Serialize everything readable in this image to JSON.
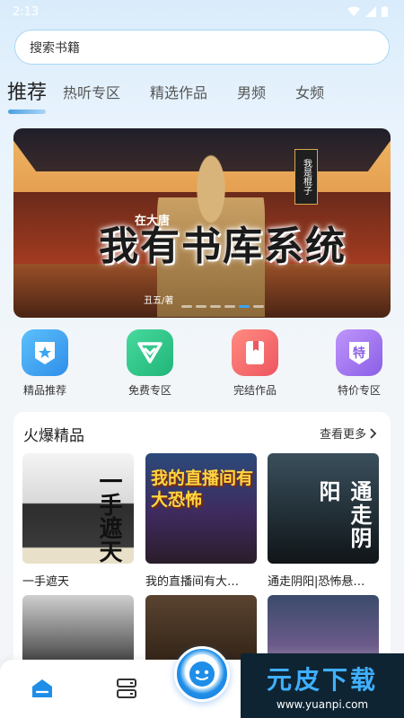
{
  "status_bar": {
    "time": "2:13"
  },
  "search": {
    "placeholder": "搜索书籍"
  },
  "tabs": [
    {
      "label": "推荐",
      "active": true
    },
    {
      "label": "热听专区"
    },
    {
      "label": "精选作品"
    },
    {
      "label": "男频"
    },
    {
      "label": "女频"
    }
  ],
  "banner": {
    "title": "我有书库系统",
    "subtitle": "在大唐",
    "author": "丑五/著",
    "tag": "我是棍子",
    "slide_count": 6,
    "active_slide": 4
  },
  "quick_entries": [
    {
      "label": "精品推荐",
      "icon": "star-badge-icon",
      "color": "#3aa6f3"
    },
    {
      "label": "免费专区",
      "icon": "heart-badge-icon",
      "color": "#2dc28a"
    },
    {
      "label": "完结作品",
      "icon": "book-icon",
      "color": "#f2656a"
    },
    {
      "label": "特价专区",
      "icon": "special-price-icon",
      "color": "#a277ef"
    }
  ],
  "hot_section": {
    "title": "火爆精品",
    "see_more": "查看更多",
    "books": [
      {
        "title": "一手遮天",
        "cover_text": "一手遮天"
      },
      {
        "title": "我的直播间有大…",
        "cover_text": "我的直播间有大恐怖"
      },
      {
        "title": "通走阴阳|恐怖悬…",
        "cover_text": "通走阴阳"
      },
      {
        "title": "",
        "cover_text": ""
      },
      {
        "title": "",
        "cover_text": ""
      },
      {
        "title": "",
        "cover_text": ""
      }
    ]
  },
  "bottom_nav": {
    "items": [
      "home-icon",
      "bookshelf-icon",
      "listen-center-icon"
    ]
  },
  "watermark": {
    "main": "元皮下载",
    "url": "www.yuanpi.com"
  }
}
